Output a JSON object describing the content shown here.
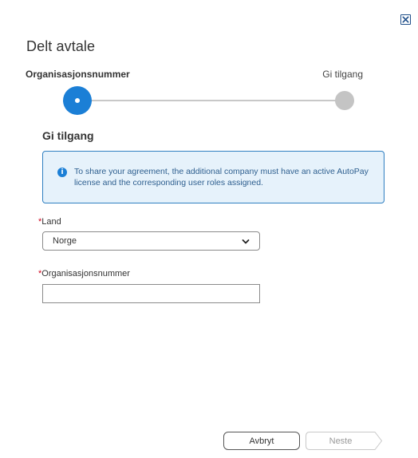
{
  "dialog": {
    "title": "Delt avtale",
    "close_icon": "close-x-icon"
  },
  "stepper": {
    "steps": [
      {
        "label": "Organisasjonsnummer",
        "state": "active"
      },
      {
        "label": "Gi tilgang",
        "state": "inactive"
      }
    ],
    "active_color": "#1b7fd6",
    "inactive_color": "#c4c4c4"
  },
  "section": {
    "heading": "Gi tilgang"
  },
  "info": {
    "icon": "info-icon",
    "icon_glyph": "i",
    "text": "To share your agreement, the additional company must have an active AutoPay license and the corresponding user roles assigned."
  },
  "form": {
    "land": {
      "required_mark": "*",
      "label": "Land",
      "value": "Norge"
    },
    "org_number": {
      "required_mark": "*",
      "label": "Organisasjonsnummer",
      "value": "",
      "placeholder": ""
    }
  },
  "footer": {
    "cancel_label": "Avbryt",
    "next_label": "Neste"
  }
}
